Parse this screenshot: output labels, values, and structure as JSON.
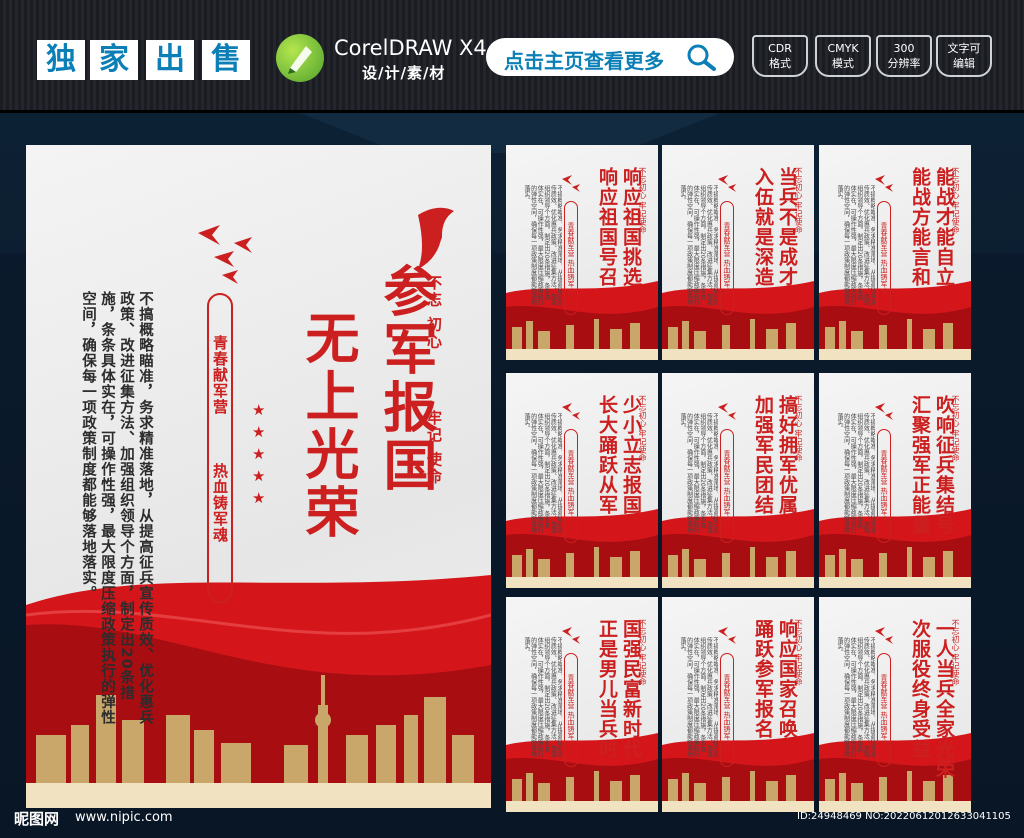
{
  "header": {
    "tiles": [
      "独",
      "家",
      "出",
      "售"
    ],
    "corel_title": "CorelDRAW X4",
    "corel_sub": "设/计/素/材",
    "search_label": "点击主页查看更多",
    "badges": [
      {
        "line1": "CDR",
        "line2": "格式"
      },
      {
        "line1": "CMYK",
        "line2": "模式"
      },
      {
        "line1": "300",
        "line2": "分辨率"
      },
      {
        "line1": "文字可",
        "line2": "编辑"
      }
    ]
  },
  "big_poster": {
    "title_line1": "参军报国",
    "title_line2": "无上光荣",
    "motto_1": "不忘 初心",
    "motto_2": "牢记 使命",
    "slogan_1": "青春献军营",
    "slogan_2": "热血铸军魂",
    "body": "不搞概略瞄准，务求精准落地，从提高征兵宣传质效、优化惠兵政策、改进征集方法、加强组织领导个方面，制定出20条措施，条条具体实在，可操作性强，最大限度压缩政策执行的弹性空间，确保每一项政策制度都能够落地落实。"
  },
  "small_posters": [
    {
      "line1": "响应祖国挑选",
      "line2": "响应祖国号召"
    },
    {
      "line1": "当兵不是成才",
      "line2": "入伍就是深造"
    },
    {
      "line1": "能战才能自立",
      "line2": "能战方能言和"
    },
    {
      "line1": "少小立志报国",
      "line2": "长大踊跃从军"
    },
    {
      "line1": "搞好拥军优属",
      "line2": "加强军民团结"
    },
    {
      "line1": "吹响征兵集结号",
      "line2": "汇聚强军正能量"
    },
    {
      "line1": "国强民富新时代",
      "line2": "正是男儿当兵时"
    },
    {
      "line1": "响应国家召唤",
      "line2": "踊跃参军报名"
    },
    {
      "line1": "一人当兵全家光荣",
      "line2": "次服役终身受益"
    }
  ],
  "small_seal": "不忘初心 牢记使命",
  "small_slogan": "青春献军营  热血铸军魂",
  "watermark": {
    "brand": "昵图网",
    "url": "www.nipic.com",
    "id": "ID:24948469 NO:20220612012633041105"
  },
  "colors": {
    "accent_red": "#cc1f1f",
    "brand_blue": "#0c7fb7",
    "green": "#4fa12c"
  }
}
